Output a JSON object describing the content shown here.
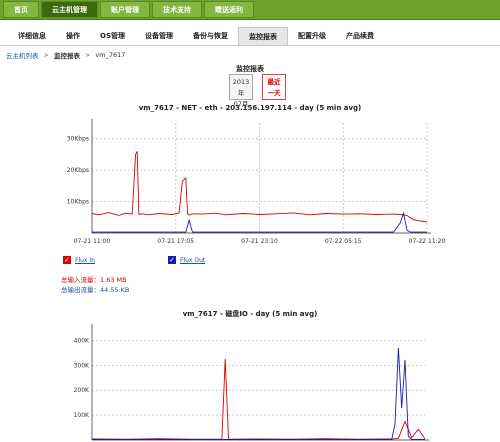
{
  "topnav": {
    "items": [
      {
        "label": "首页"
      },
      {
        "label": "云主机管理"
      },
      {
        "label": "账户管理"
      },
      {
        "label": "技术支持"
      },
      {
        "label": "赠送返利"
      }
    ],
    "active_index": 1
  },
  "subnav": {
    "items": [
      {
        "label": "详细信息"
      },
      {
        "label": "操作"
      },
      {
        "label": "OS管理"
      },
      {
        "label": "设备管理"
      },
      {
        "label": "备份与恢复"
      },
      {
        "label": "监控报表"
      },
      {
        "label": "配置升级"
      },
      {
        "label": "产品续费"
      }
    ],
    "active_index": 5
  },
  "breadcrumb": {
    "root": "云主机列表",
    "section": "监控报表",
    "current": "vm_7617",
    "separator": ">"
  },
  "panel": {
    "title": "监控报表",
    "date_year": "2013年",
    "date_month": "07月",
    "last_day_line1": "最近",
    "last_day_line2": "一天"
  },
  "net_chart": {
    "title": "vm_7617 - NET - eth - 203.156.197.114 -  day (5 min avg)",
    "legend_in": "Flux In",
    "legend_out": "Flux Out",
    "total_in_label": "总输入流量：",
    "total_in_value": "1.63 MB",
    "total_out_label": "总输出流量：",
    "total_out_value": "44.55 KB"
  },
  "disk_chart": {
    "title": "vm_7617 - 磁盘IO -  day (5 min avg)"
  },
  "colors": {
    "accent_green": "#6fa12e",
    "series_in": "#dd0000",
    "series_out": "#1a1ab0"
  },
  "chart_data": [
    {
      "type": "line",
      "title": "vm_7617 - NET - eth - 203.156.197.114 -  day (5 min avg)",
      "x_tick_labels": [
        "07-21 11:00",
        "07-21 17:05",
        "07-21 23:10",
        "07-22 05:15",
        "07-22 11:20"
      ],
      "y_tick_labels": [
        "10Kbps",
        "20Kbps",
        "30Kbps"
      ],
      "ylim": [
        0,
        35000
      ],
      "grid": true,
      "series": [
        {
          "name": "Flux In",
          "color": "#dd0000",
          "x": [
            0,
            0.02,
            0.05,
            0.08,
            0.1,
            0.12,
            0.13,
            0.135,
            0.14,
            0.15,
            0.17,
            0.2,
            0.24,
            0.26,
            0.27,
            0.28,
            0.285,
            0.29,
            0.3,
            0.33,
            0.37,
            0.4,
            0.45,
            0.5,
            0.55,
            0.6,
            0.65,
            0.7,
            0.75,
            0.8,
            0.85,
            0.9,
            0.92,
            0.94,
            0.96,
            1.0
          ],
          "y": [
            6200,
            5800,
            6500,
            5600,
            6300,
            6000,
            25000,
            26000,
            5900,
            6100,
            5800,
            6200,
            5900,
            6400,
            16500,
            17500,
            6200,
            5700,
            6100,
            6000,
            6300,
            5800,
            6200,
            5900,
            6100,
            6400,
            5800,
            6200,
            6000,
            6100,
            5900,
            6000,
            5900,
            5600,
            4200,
            3500
          ]
        },
        {
          "name": "Flux Out",
          "color": "#1a1ab0",
          "x": [
            0,
            0.1,
            0.2,
            0.28,
            0.29,
            0.3,
            0.4,
            0.5,
            0.6,
            0.7,
            0.8,
            0.9,
            0.92,
            0.93,
            0.94,
            0.95,
            1.0
          ],
          "y": [
            300,
            300,
            300,
            300,
            4000,
            300,
            300,
            300,
            300,
            300,
            300,
            300,
            3200,
            6300,
            1000,
            300,
            300
          ]
        }
      ]
    },
    {
      "type": "line",
      "title": "vm_7617 - 磁盘IO -  day (5 min avg)",
      "y_tick_labels": [
        "100K",
        "200K",
        "300K",
        "400K"
      ],
      "ylim": [
        0,
        420000
      ],
      "grid": true,
      "series": [
        {
          "color": "#dd0000",
          "x": [
            0,
            0.1,
            0.2,
            0.3,
            0.39,
            0.4,
            0.41,
            0.5,
            0.6,
            0.7,
            0.8,
            0.9,
            0.92,
            0.94,
            0.96,
            0.98,
            1.0
          ],
          "y": [
            4000,
            3000,
            5000,
            3000,
            3000,
            305000,
            3000,
            4000,
            3000,
            5000,
            3000,
            4000,
            6000,
            70000,
            9000,
            40000,
            5000
          ]
        },
        {
          "color": "#1a1ab0",
          "x": [
            0,
            0.1,
            0.2,
            0.3,
            0.4,
            0.5,
            0.6,
            0.7,
            0.8,
            0.9,
            0.91,
            0.92,
            0.93,
            0.94,
            0.95,
            0.96,
            1.0
          ],
          "y": [
            2000,
            2000,
            2000,
            2000,
            2000,
            2000,
            2000,
            2000,
            2000,
            2000,
            60000,
            345000,
            120000,
            300000,
            15000,
            2000,
            2000
          ]
        }
      ]
    }
  ]
}
